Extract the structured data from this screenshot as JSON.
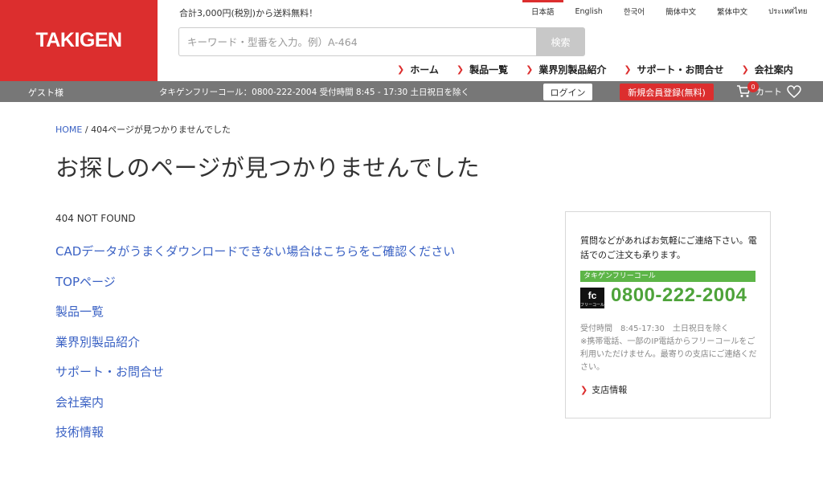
{
  "header": {
    "logo": "TAKIGEN",
    "shipping_notice": "合計3,000円(税別)から送料無料！",
    "languages": [
      "日本語",
      "English",
      "한국어",
      "簡体中文",
      "繁体中文",
      "ประเทศไทย"
    ],
    "active_language": "日本語",
    "search": {
      "placeholder": "キーワード・型番を入力。例）A-464",
      "button": "検索"
    },
    "nav": [
      "ホーム",
      "製品一覧",
      "業界別製品紹介",
      "サポート・お問合せ",
      "会社案内"
    ]
  },
  "subbar": {
    "guest": "ゲスト様",
    "freecall": "タキゲンフリーコール：0800-222-2004 受付時間 8:45 - 17:30 土日祝日を除く",
    "login": "ログイン",
    "register": "新規会員登録(無料)",
    "cart_count": "0",
    "cart_label": "カート"
  },
  "breadcrumb": {
    "home": "HOME",
    "separator": "/",
    "current": "404ページが見つかりませんでした"
  },
  "page": {
    "title": "お探しのページが見つかりませんでした",
    "status": "404 NOT FOUND",
    "links": [
      "CADデータがうまくダウンロードできない場合はこちらをご確認ください",
      "TOPページ",
      "製品一覧",
      "業界別製品紹介",
      "サポート・お問合せ",
      "会社案内",
      "技術情報"
    ]
  },
  "contact": {
    "intro": "質問などがあればお気軽にご連絡下さい。電話でのご注文も承ります。",
    "freecall_label": "タキゲンフリーコール",
    "logo_text": "fc",
    "logo_sub": "フリーコール",
    "phone": "0800-222-2004",
    "hours": "受付時間　8:45-17:30　土日祝日を除く",
    "note": "※携帯電話、一部のIP電話からフリーコールをご利用いただけません。最寄りの支店にご連絡ください。",
    "branch_link": "支店情報"
  },
  "colors": {
    "brand_red": "#dc2e2e",
    "link_blue": "#3b62c4",
    "freecall_green": "#5db548",
    "bar_gray": "#777777"
  }
}
